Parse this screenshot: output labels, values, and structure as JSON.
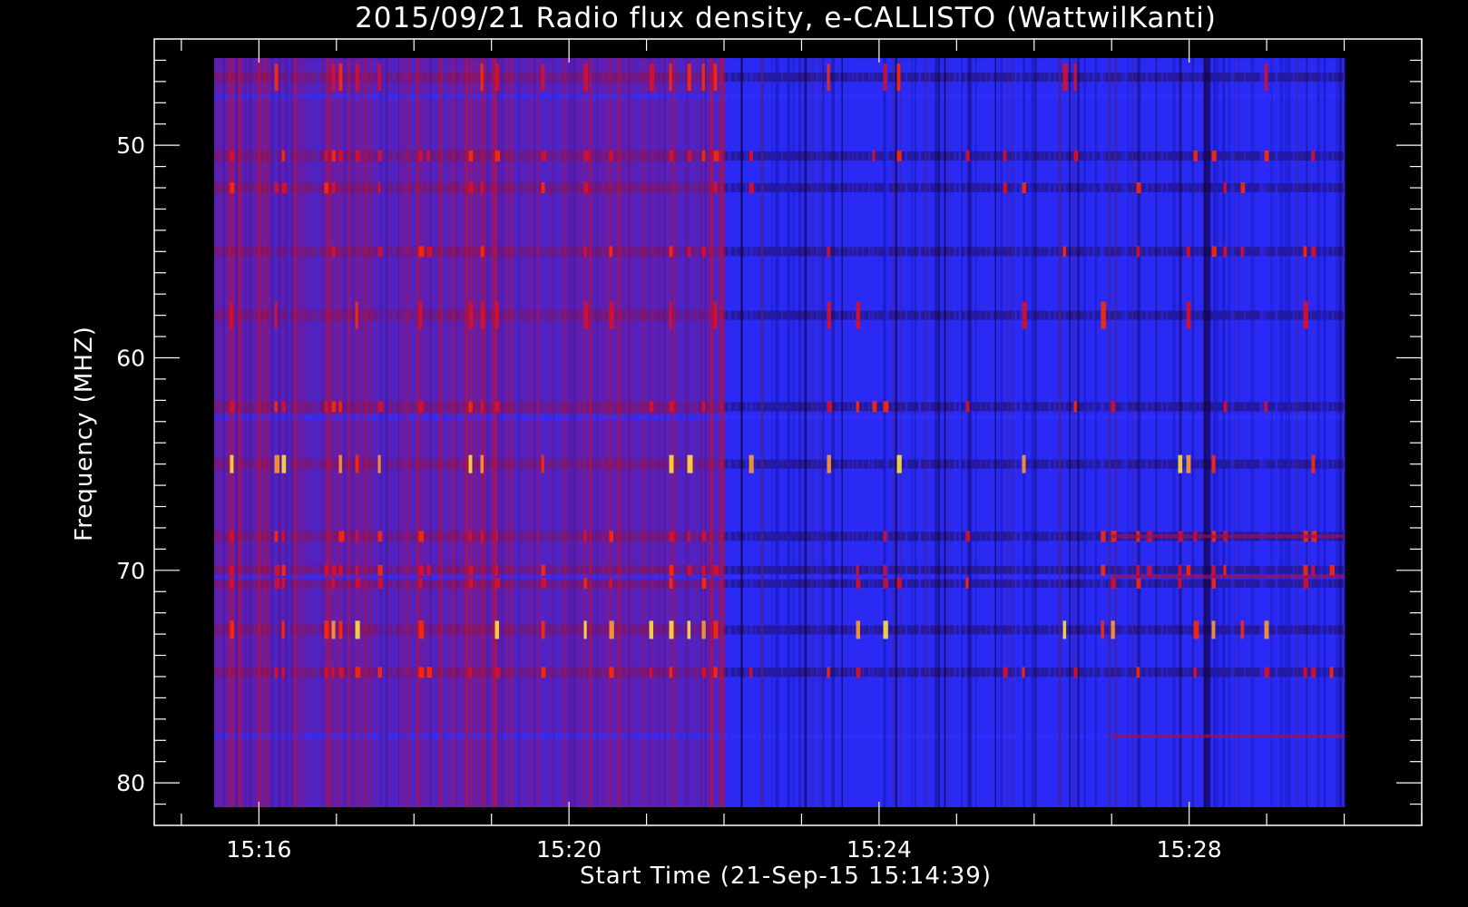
{
  "chart_data": {
    "type": "heatmap",
    "title": "2015/09/21  Radio flux density, e-CALLISTO (WattwilKanti)",
    "xlabel": "Start Time (21-Sep-15 15:14:39)",
    "ylabel": "Frequency (MHZ)",
    "x_tick_labels": [
      "15:16",
      "15:20",
      "15:24",
      "15:28"
    ],
    "y_tick_labels": [
      "50",
      "60",
      "70",
      "80"
    ],
    "y_tick_values": [
      50,
      60,
      70,
      80
    ],
    "ylim": [
      45,
      82
    ],
    "y_inverted": true,
    "x_range": [
      "15:14:39",
      "15:31:00"
    ],
    "data_x_range": [
      "15:15:25",
      "15:30:00"
    ],
    "data_y_range": [
      45.9,
      81.5
    ],
    "segment_change_time": "15:22:00",
    "colormap": [
      "#000000",
      "#1a0066",
      "#2020ff",
      "#6a1aa0",
      "#b0102a",
      "#ff2a00",
      "#ff9a30",
      "#ffe040"
    ],
    "hot_bands_mhz": [
      46.8,
      50.5,
      52.0,
      55.0,
      58.0,
      62.3,
      65.0,
      68.4,
      70.0,
      70.6,
      72.8,
      74.8
    ],
    "grid": false,
    "legend": "none",
    "background_color": "#000000",
    "axis_color": "#ffffff"
  }
}
